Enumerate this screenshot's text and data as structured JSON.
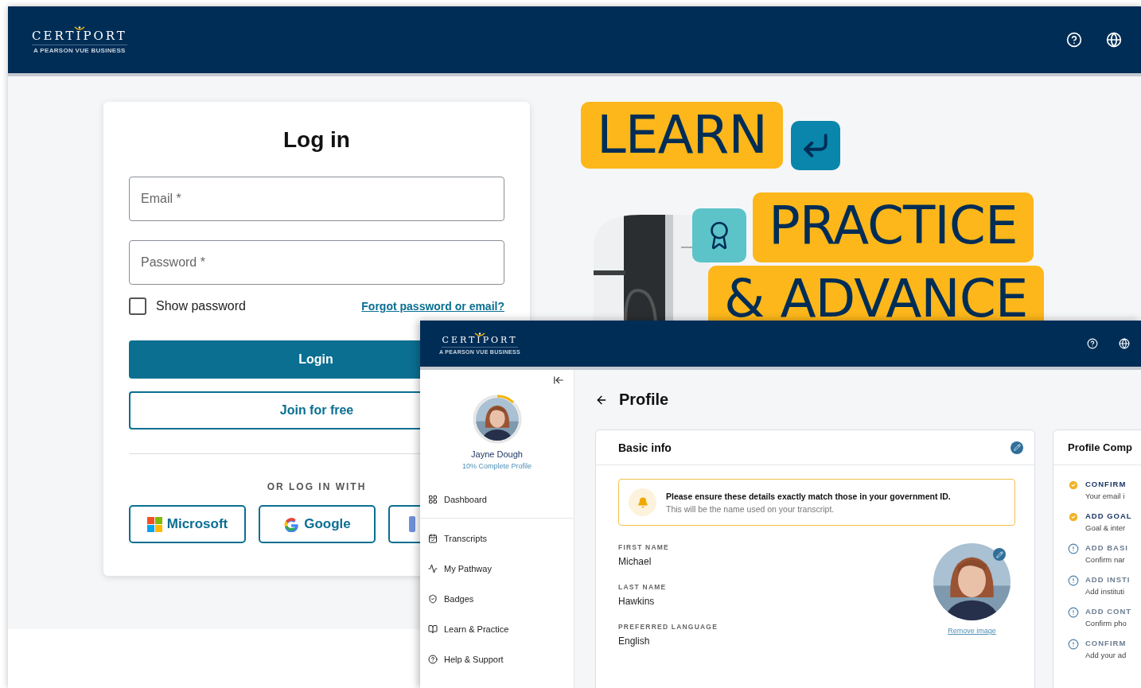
{
  "login_window": {
    "logo": {
      "wordmark": "CERTIPORT",
      "tagline": "A PEARSON VUE BUSINESS"
    },
    "login_card": {
      "title": "Log in",
      "fields": [
        {
          "placeholder": "Email *"
        },
        {
          "placeholder": "Password *"
        }
      ],
      "show_password": {
        "label": "Show password",
        "checked": false
      },
      "forgot_link": "Forgot password or email?",
      "login_button": "Login",
      "join_button": "Join for free",
      "divider_label": "OR LOG IN WITH",
      "providers": [
        {
          "kind": "microsoft",
          "label": "Microsoft"
        },
        {
          "kind": "google",
          "label": "Google"
        },
        {
          "kind": "other"
        }
      ]
    },
    "hero": {
      "lines": [
        "LEARN",
        "PRACTICE",
        "& ADVANCE"
      ]
    }
  },
  "profile_window": {
    "logo": {
      "wordmark": "CERTIPORT",
      "tagline": "A PEARSON VUE BUSINESS"
    },
    "sidebar": {
      "user_name": "Jayne Dough",
      "completion": "10% Complete Profile",
      "profile_ring": {
        "level": 0.12
      },
      "sections": [
        {
          "items": [
            {
              "kind": "dashboard",
              "label": "Dashboard"
            }
          ]
        },
        {
          "items": [
            {
              "kind": "transcripts",
              "label": "Transcripts"
            },
            {
              "kind": "pathway",
              "label": "My Pathway"
            },
            {
              "kind": "badges",
              "label": "Badges"
            },
            {
              "kind": "learn",
              "label": "Learn & Practice"
            },
            {
              "kind": "help",
              "label": "Help & Support"
            }
          ]
        }
      ]
    },
    "page_title": "Profile",
    "basic_info": {
      "title": "Basic info",
      "notice": {
        "title": "Please ensure these details exactly match those in your government ID.",
        "text": "This will be the name used on your transcript."
      },
      "fields": [
        {
          "label": "FIRST NAME",
          "value": "Michael"
        },
        {
          "label": "LAST NAME",
          "value": "Hawkins"
        },
        {
          "label": "PREFERRED LANGUAGE",
          "value": "English"
        }
      ],
      "remove_image": "Remove image"
    },
    "completion_card": {
      "title": "Profile Comp",
      "steps": [
        {
          "title": "CONFIRM",
          "text": "Your email i",
          "done": true
        },
        {
          "title": "ADD GOAL",
          "text": "Goal & inter",
          "done": true
        },
        {
          "title": "ADD BASI",
          "text": "Confirm nar",
          "done": false
        },
        {
          "title": "ADD INSTI",
          "text": "Add instituti",
          "done": false
        },
        {
          "title": "ADD CONT",
          "text": "Confirm pho",
          "done": false
        },
        {
          "title": "CONFIRM",
          "text": "Add your ad",
          "done": false
        }
      ]
    }
  }
}
